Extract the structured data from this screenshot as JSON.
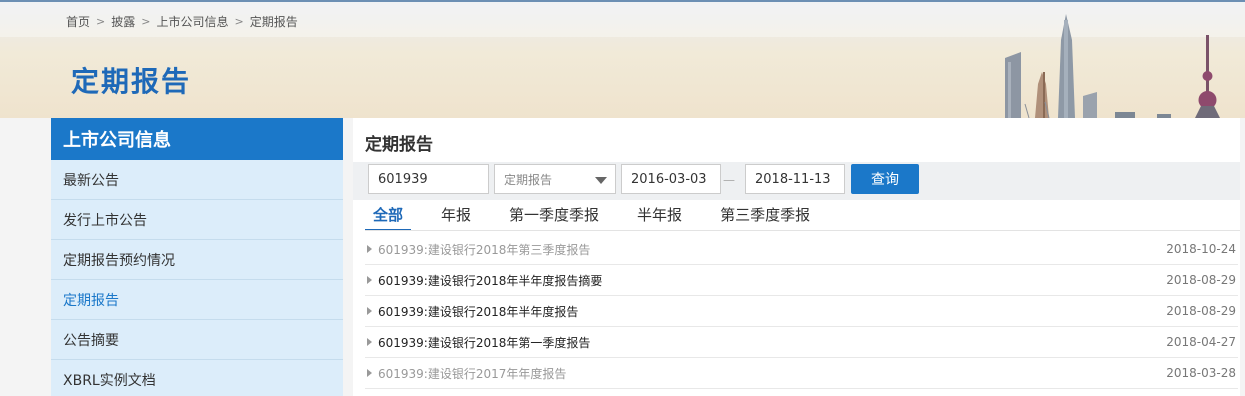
{
  "breadcrumb": [
    "首页",
    "披露",
    "上市公司信息",
    "定期报告"
  ],
  "page_title": "定期报告",
  "sidebar": {
    "header": "上市公司信息",
    "items": [
      {
        "label": "最新公告"
      },
      {
        "label": "发行上市公告"
      },
      {
        "label": "定期报告预约情况"
      },
      {
        "label": "定期报告"
      },
      {
        "label": "公告摘要"
      },
      {
        "label": "XBRL实例文档"
      }
    ],
    "active_index": 3
  },
  "main": {
    "title": "定期报告",
    "search": {
      "code_value": "601939",
      "type_value": "定期报告",
      "start_date": "2016-03-03",
      "date_separator": "—",
      "end_date": "2018-11-13",
      "query_label": "查询"
    },
    "tabs": [
      "全部",
      "年报",
      "第一季度季报",
      "半年报",
      "第三季度季报"
    ],
    "reports": [
      {
        "title": "601939:建设银行2018年第三季度报告",
        "date": "2018-10-24"
      },
      {
        "title": "601939:建设银行2018年半年度报告摘要",
        "date": "2018-08-29"
      },
      {
        "title": "601939:建设银行2018年半年度报告",
        "date": "2018-08-29"
      },
      {
        "title": "601939:建设银行2018年第一季度报告",
        "date": "2018-04-27"
      },
      {
        "title": "601939:建设银行2017年年度报告",
        "date": "2018-03-28"
      }
    ]
  },
  "colors": {
    "accent": "#1b78c9",
    "sidebar_bg": "#dcedfa",
    "title_blue": "#1e69b8"
  },
  "icons": {
    "breadcrumb_separator": "chevron-right-icon",
    "row_marker": "triangle-right-icon",
    "select_caret": "caret-down-icon"
  }
}
